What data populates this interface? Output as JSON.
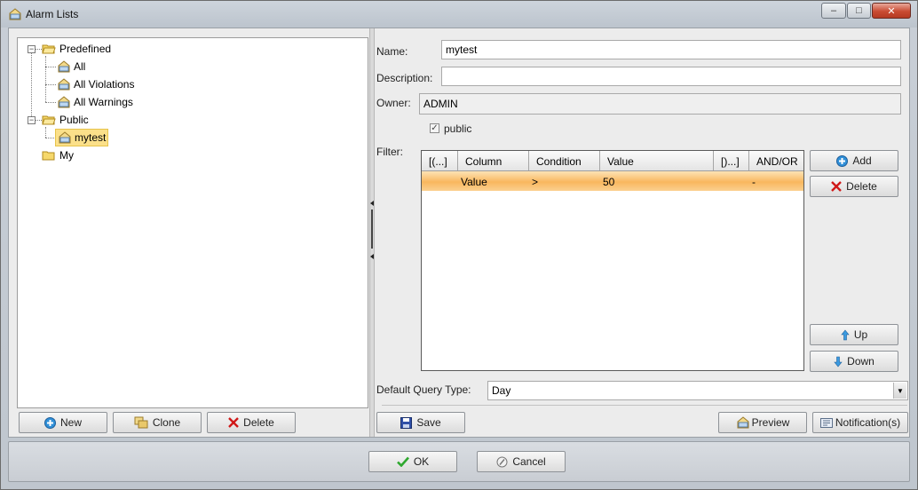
{
  "window": {
    "title": "Alarm Lists",
    "minimize_glyph": "–",
    "maximize_glyph": "□",
    "close_glyph": "✕"
  },
  "tree": {
    "predefined": {
      "label": "Predefined",
      "children": [
        "All",
        "All Violations",
        "All Warnings"
      ]
    },
    "public": {
      "label": "Public",
      "children": [
        "mytest"
      ]
    },
    "my": {
      "label": "My"
    }
  },
  "left_buttons": {
    "new": "New",
    "clone": "Clone",
    "delete": "Delete"
  },
  "form": {
    "name_label": "Name:",
    "name_value": "mytest",
    "description_label": "Description:",
    "description_value": "",
    "owner_label": "Owner:",
    "owner_value": "ADMIN",
    "public_label": "public",
    "public_checked": true,
    "filter_label": "Filter:",
    "query_type_label": "Default Query Type:",
    "query_type_value": "Day"
  },
  "filter_grid": {
    "columns": [
      "[(...]",
      "Column",
      "Condition",
      "Value",
      "[)...]",
      "AND/OR"
    ],
    "rows": [
      {
        "open": "",
        "column": "Value",
        "condition": ">",
        "value": "50",
        "close": "",
        "andor": "-"
      }
    ]
  },
  "filter_buttons": {
    "add": "Add",
    "delete": "Delete",
    "up": "Up",
    "down": "Down"
  },
  "bottom_right_buttons": {
    "save": "Save",
    "preview": "Preview",
    "notifications": "Notification(s)"
  },
  "dialog_buttons": {
    "ok": "OK",
    "cancel": "Cancel"
  },
  "colors": {
    "selected_row": "#f9b75e",
    "tree_selection": "#fbe08a",
    "add_icon": "#2f8fd8",
    "delete_icon": "#d01818",
    "ok_icon": "#2ea82e"
  }
}
